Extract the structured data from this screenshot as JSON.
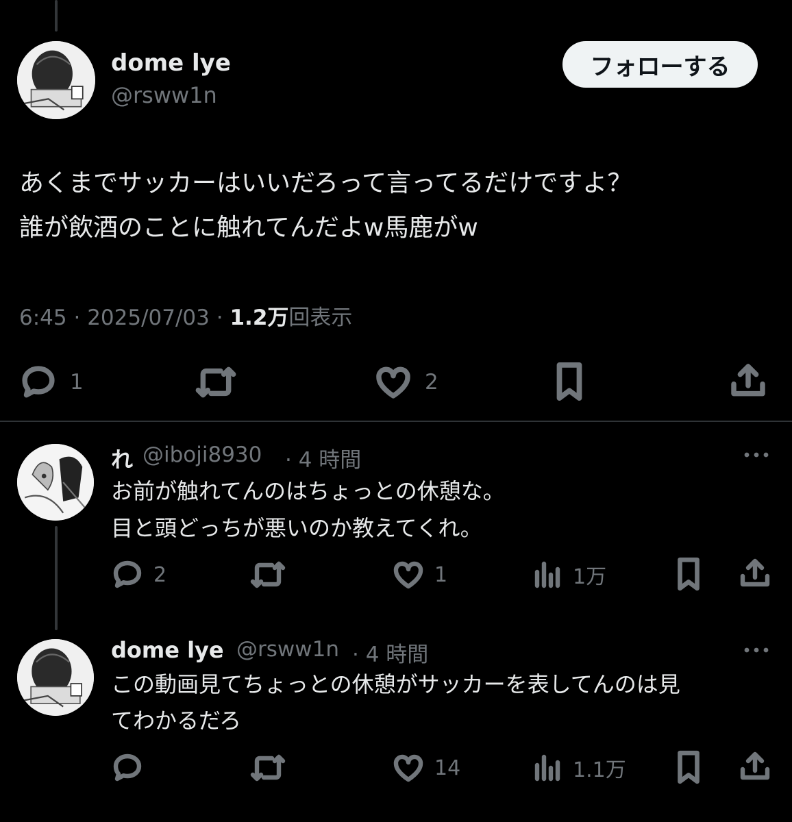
{
  "main_tweet": {
    "author_name": "dome lye",
    "author_handle": "@rsww1n",
    "follow_label": "フォローする",
    "text_line1": "あくまでサッカーはいいだろって言ってるだけですよ？",
    "text_line2": "誰が飲酒のことに触れてんだよw馬鹿がw",
    "time": "6:45",
    "separator": "·",
    "date": "2025/07/03",
    "views_count": "1.2万",
    "views_label": "回表示",
    "reply_count": "1",
    "like_count": "2"
  },
  "replies": [
    {
      "author_name": "れ",
      "author_handle": "@iboji8930",
      "time_ago": "· 4 時間",
      "text_line1": "お前が触れてんのはちょっとの休憩な。",
      "text_line2": "目と頭どっちが悪いのか教えてくれ。",
      "reply_count": "2",
      "like_count": "1",
      "view_count": "1万"
    },
    {
      "author_name": "dome lye",
      "author_handle": "@rsww1n",
      "time_ago": "· 4 時間",
      "text_line1": "この動画見てちょっとの休憩がサッカーを表してんのは見",
      "text_line2": "てわかるだろ",
      "reply_count": "",
      "like_count": "14",
      "view_count": "1.1万"
    }
  ],
  "colors": {
    "background": "#000000",
    "text": "#e7e9ea",
    "secondary": "#71767b",
    "divider": "#2f3336",
    "follow_bg": "#eff3f4"
  },
  "icons": [
    "reply-icon",
    "retweet-icon",
    "like-icon",
    "bookmark-icon",
    "share-icon",
    "views-icon",
    "more-icon"
  ]
}
